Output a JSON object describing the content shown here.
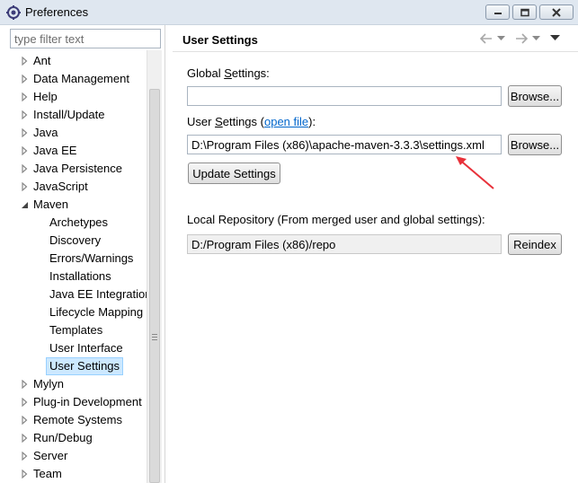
{
  "window": {
    "title": "Preferences"
  },
  "sidebar": {
    "filter_placeholder": "type filter text",
    "items": [
      {
        "label": "Ant",
        "level": 0,
        "expanded": false
      },
      {
        "label": "Data Management",
        "level": 0,
        "expanded": false
      },
      {
        "label": "Help",
        "level": 0,
        "expanded": false
      },
      {
        "label": "Install/Update",
        "level": 0,
        "expanded": false
      },
      {
        "label": "Java",
        "level": 0,
        "expanded": false
      },
      {
        "label": "Java EE",
        "level": 0,
        "expanded": false
      },
      {
        "label": "Java Persistence",
        "level": 0,
        "expanded": false
      },
      {
        "label": "JavaScript",
        "level": 0,
        "expanded": false
      },
      {
        "label": "Maven",
        "level": 0,
        "expanded": true
      },
      {
        "label": "Archetypes",
        "level": 1
      },
      {
        "label": "Discovery",
        "level": 1
      },
      {
        "label": "Errors/Warnings",
        "level": 1
      },
      {
        "label": "Installations",
        "level": 1
      },
      {
        "label": "Java EE Integration",
        "level": 1
      },
      {
        "label": "Lifecycle Mapping",
        "level": 1
      },
      {
        "label": "Templates",
        "level": 1
      },
      {
        "label": "User Interface",
        "level": 1
      },
      {
        "label": "User Settings",
        "level": 1,
        "selected": true
      },
      {
        "label": "Mylyn",
        "level": 0,
        "expanded": false
      },
      {
        "label": "Plug-in Development",
        "level": 0,
        "expanded": false
      },
      {
        "label": "Remote Systems",
        "level": 0,
        "expanded": false
      },
      {
        "label": "Run/Debug",
        "level": 0,
        "expanded": false
      },
      {
        "label": "Server",
        "level": 0,
        "expanded": false
      },
      {
        "label": "Team",
        "level": 0,
        "expanded": false
      }
    ]
  },
  "main": {
    "title": "User Settings",
    "global_settings": {
      "label_prefix": "Global ",
      "label_mnemonic": "S",
      "label_suffix": "ettings:",
      "value": "",
      "browse_label": "Browse..."
    },
    "user_settings": {
      "label_prefix": "User ",
      "label_mnemonic": "S",
      "label_suffix": "ettings (",
      "link_text": "open file",
      "label_end": "):",
      "value": "D:\\Program Files (x86)\\apache-maven-3.3.3\\settings.xml",
      "browse_label": "Browse...",
      "update_label": "Update Settings"
    },
    "local_repository": {
      "label": "Local Repository (From merged user and global settings):",
      "value": "D:/Program Files (x86)/repo",
      "reindex_label": "Reindex"
    }
  },
  "colors": {
    "selection_bg": "#cce8ff",
    "link": "#0066cc",
    "annotation_arrow": "#e8313a"
  }
}
